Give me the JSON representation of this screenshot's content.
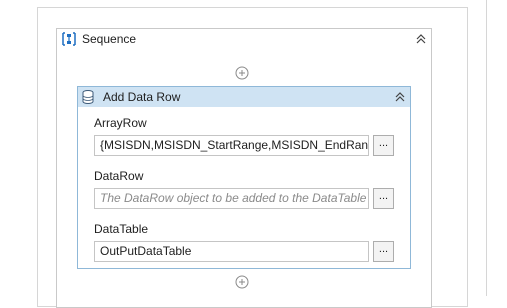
{
  "sequence": {
    "title": "Sequence",
    "icon": "sequence-icon"
  },
  "activity": {
    "title": "Add Data Row",
    "icon": "database-icon",
    "fields": [
      {
        "label": "ArrayRow",
        "value": "{MSISDN,MSISDN_StartRange,MSISDN_EndRange,",
        "placeholder": "",
        "button": "..."
      },
      {
        "label": "DataRow",
        "value": "",
        "placeholder": "The DataRow object to be added to the DataTable",
        "button": "..."
      },
      {
        "label": "DataTable",
        "value": "OutPutDataTable",
        "placeholder": "",
        "button": "..."
      }
    ]
  },
  "colors": {
    "activity_header": "#cfe3f3",
    "activity_border": "#8fb8d8",
    "sequence_icon": "#1f6fc2"
  }
}
